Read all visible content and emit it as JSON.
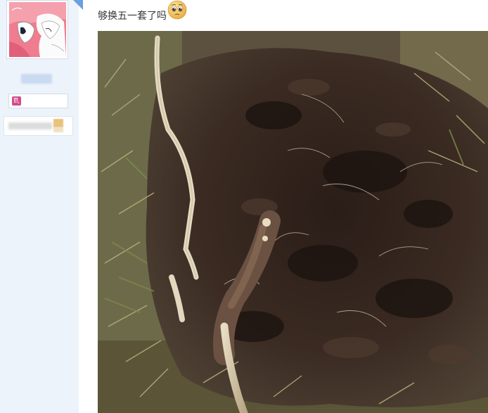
{
  "sidebar": {
    "avatar_icon": "anime-avatar",
    "zodiac_symbol": "♏",
    "zodiac_icon": "scorpio-icon",
    "colors": {
      "sidebar_bg": "#edf3fb",
      "zodiac": "#d14b8d",
      "corner": "#6a9fe0"
    }
  },
  "post": {
    "text": "够换五一套了吗",
    "emoji_icon": "pleading-face-emoji",
    "image_icon": "photo-dug-soil-root"
  }
}
